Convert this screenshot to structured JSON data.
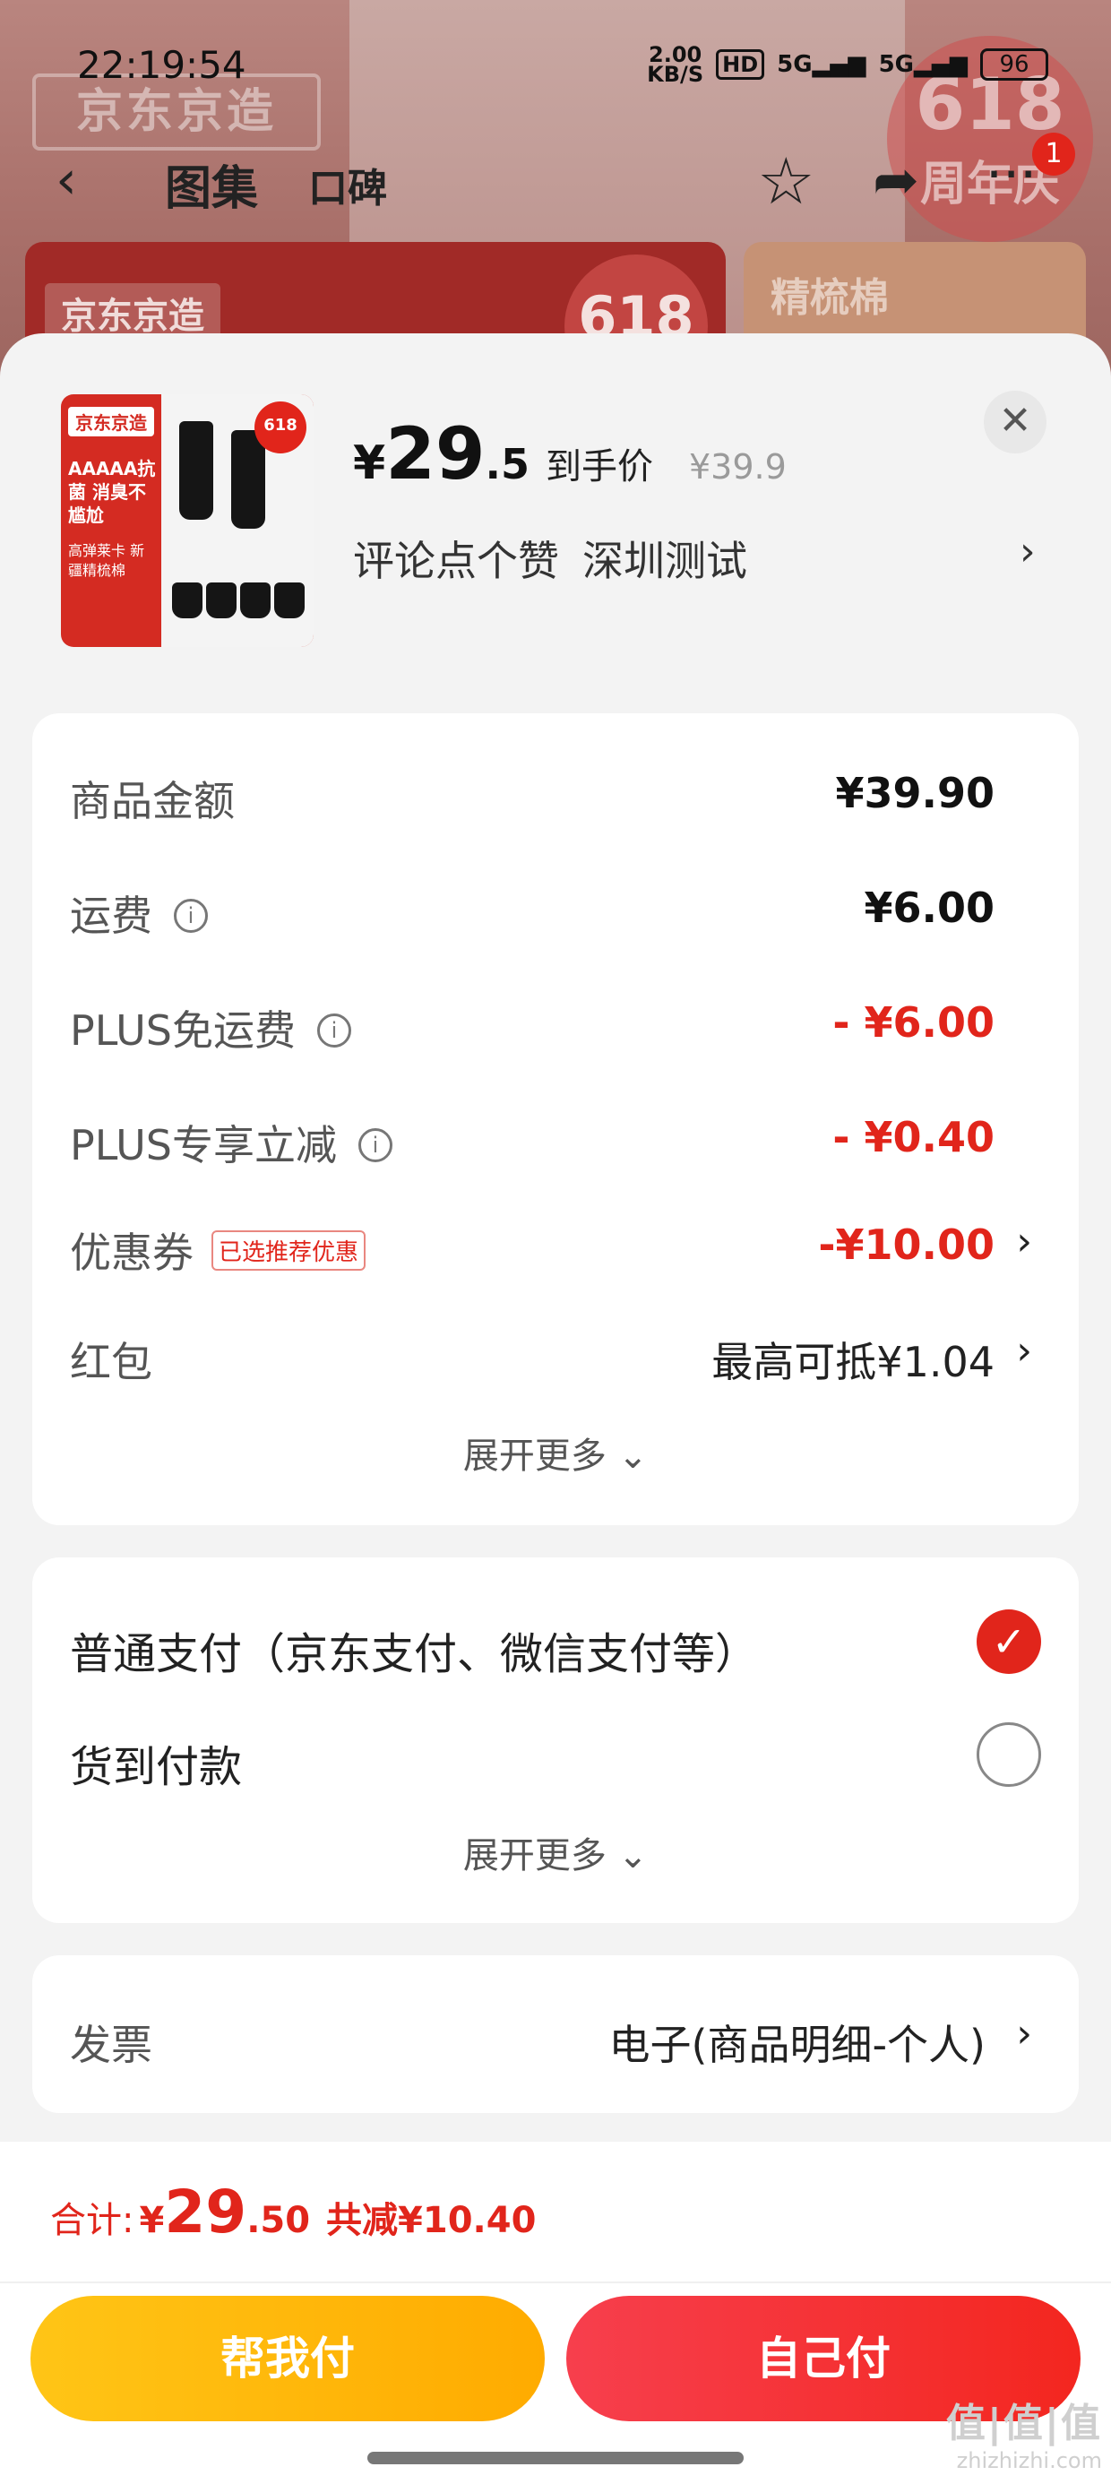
{
  "status_bar": {
    "time": "22:19:54",
    "net_speed": "2.00",
    "net_unit": "KB/S",
    "hd": "HD",
    "signal_1": "5G",
    "signal_2": "5G",
    "battery": "96"
  },
  "background": {
    "logo": "京东京造",
    "tab_gallery": "图集",
    "tab_reviews": "口碑",
    "badge_618": "618",
    "badge_anniv": "周年庆",
    "cart_count": "1",
    "thumb_label_a": "京东京造",
    "thumb_badge_a": "618",
    "thumb_label_b": "精梳棉"
  },
  "product": {
    "image_brand": "京东京造",
    "image_promo": "AAAAA抗菌 消臭不尴尬",
    "image_sub": "高弹莱卡 新疆精梳棉",
    "image_badge": "618",
    "price_currency": "¥",
    "price_int": "29",
    "price_dec": ".5",
    "price_label": "到手价",
    "original_price": "¥39.9",
    "promo_1": "评论点个赞",
    "promo_2": "深圳测试"
  },
  "fees": {
    "rows": [
      {
        "label": "商品金额",
        "value": "¥39.90"
      },
      {
        "label": "运费",
        "value": "¥6.00"
      },
      {
        "label": "PLUS免运费",
        "value": "- ¥6.00"
      },
      {
        "label": "PLUS专享立减",
        "value": "- ¥0.40"
      },
      {
        "label": "优惠券",
        "tag": "已选推荐优惠",
        "value": "-¥10.00"
      },
      {
        "label": "红包",
        "value": "最高可抵¥1.04"
      }
    ],
    "expand": "展开更多"
  },
  "payment": {
    "options": [
      {
        "label": "普通支付（京东支付、微信支付等）",
        "selected": true
      },
      {
        "label": "货到付款",
        "selected": false
      }
    ],
    "expand": "展开更多"
  },
  "invoice": {
    "label": "发票",
    "value": "电子(商品明细-个人)"
  },
  "footer": {
    "total_label": "合计:",
    "total_currency": "¥",
    "total_int": "29",
    "total_dec": ".50",
    "savings": "共减¥10.40",
    "help_pay": "帮我付",
    "self_pay": "自己付"
  },
  "watermark": {
    "big": "值|值|值",
    "small": "zhizhizhi.com"
  },
  "colors": {
    "accent_red": "#e1251b",
    "help_yellow": "#ffb300",
    "sheet_bg": "#f3f3f3"
  }
}
